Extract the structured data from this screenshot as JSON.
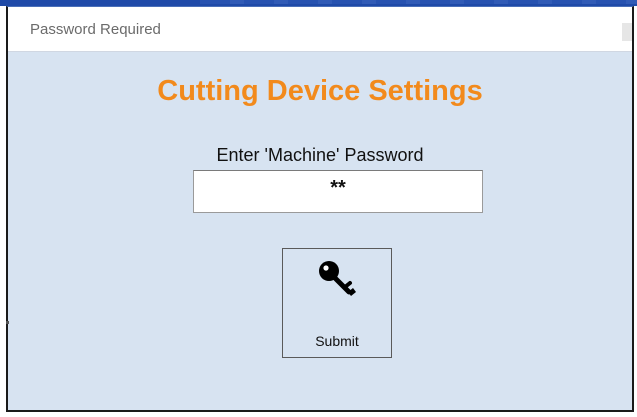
{
  "window": {
    "title": "Password Required"
  },
  "dialog": {
    "heading": "Cutting Device Settings",
    "password_label": "Enter 'Machine' Password",
    "password_value": "**",
    "submit_label": "Submit",
    "submit_icon": "key-icon"
  },
  "colors": {
    "heading": "#f28a1c",
    "background": "#d7e3f1",
    "titlebar": "#ffffff"
  }
}
